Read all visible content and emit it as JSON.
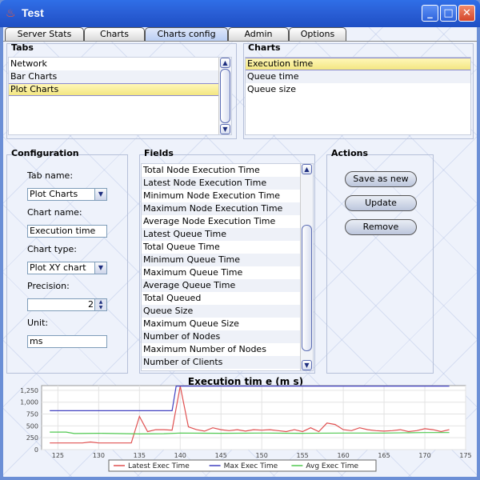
{
  "window": {
    "title": "Test",
    "controls": {
      "minimize": "_",
      "maximize": "□",
      "close": "✕"
    }
  },
  "tabs": [
    "Server Stats",
    "Charts",
    "Charts config",
    "Admin",
    "Options"
  ],
  "active_tab": "Charts config",
  "tabs_panel": {
    "title": "Tabs",
    "items": [
      "Network",
      "Bar Charts",
      "Plot Charts"
    ],
    "selected": "Plot Charts"
  },
  "charts_panel": {
    "title": "Charts",
    "items": [
      "Execution time",
      "Queue time",
      "Queue size"
    ],
    "selected": "Execution time"
  },
  "configuration": {
    "title": "Configuration",
    "tab_name_label": "Tab name:",
    "tab_name_value": "Plot Charts",
    "chart_name_label": "Chart name:",
    "chart_name_value": "Execution time",
    "chart_type_label": "Chart type:",
    "chart_type_value": "Plot XY chart",
    "precision_label": "Precision:",
    "precision_value": "2",
    "unit_label": "Unit:",
    "unit_value": "ms"
  },
  "fields": {
    "title": "Fields",
    "items": [
      "Total Node Execution Time",
      "Latest Node Execution Time",
      "Minimum Node Execution Time",
      "Maximum Node Execution Time",
      "Average Node Execution Time",
      "Latest Queue Time",
      "Total Queue Time",
      "Minimum Queue Time",
      "Maximum Queue Time",
      "Average Queue Time",
      "Total Queued",
      "Queue Size",
      "Maximum Queue Size",
      "Number of Nodes",
      "Maximum Number of Nodes",
      "Number of Clients"
    ]
  },
  "actions": {
    "title": "Actions",
    "save_label": "Save as new",
    "update_label": "Update",
    "remove_label": "Remove"
  },
  "chart_data": {
    "type": "line",
    "title": "Execution tim e (m s)",
    "xlim": [
      123,
      175
    ],
    "ylim": [
      0,
      1350
    ],
    "xticks": [
      "125",
      "130",
      "135",
      "140",
      "145",
      "150",
      "155",
      "160",
      "165",
      "170",
      "175"
    ],
    "yticks": [
      "0",
      "250",
      "500",
      "750",
      "1,000",
      "1,250"
    ],
    "grid": true,
    "legend_position": "bottom",
    "series": [
      {
        "name": "Latest Exec Time",
        "color": "#e05050",
        "x": [
          124,
          125,
          126,
          127,
          128,
          129,
          130,
          131,
          132,
          133,
          134,
          135,
          136,
          137,
          138,
          139,
          140,
          141,
          142,
          143,
          144,
          145,
          146,
          147,
          148,
          149,
          150,
          151,
          152,
          153,
          154,
          155,
          156,
          157,
          158,
          159,
          160,
          161,
          162,
          163,
          164,
          165,
          166,
          167,
          168,
          169,
          170,
          171,
          172,
          173
        ],
        "y": [
          140,
          140,
          140,
          140,
          140,
          160,
          140,
          140,
          140,
          140,
          140,
          700,
          380,
          420,
          420,
          410,
          1340,
          480,
          420,
          390,
          460,
          420,
          400,
          420,
          390,
          420,
          410,
          420,
          400,
          380,
          420,
          380,
          460,
          380,
          560,
          530,
          420,
          400,
          460,
          420,
          400,
          390,
          400,
          420,
          380,
          400,
          440,
          420,
          380,
          420
        ]
      },
      {
        "name": "Max Exec Time",
        "color": "#4040c0",
        "x": [
          124,
          139,
          139.5,
          173
        ],
        "y": [
          820,
          820,
          1340,
          1340
        ]
      },
      {
        "name": "Avg Exec Time",
        "color": "#50c850",
        "x": [
          124,
          126,
          127,
          130,
          135,
          138,
          140,
          145,
          150,
          155,
          160,
          165,
          170,
          173
        ],
        "y": [
          370,
          370,
          340,
          345,
          330,
          335,
          350,
          345,
          350,
          345,
          350,
          350,
          360,
          360
        ]
      }
    ]
  }
}
